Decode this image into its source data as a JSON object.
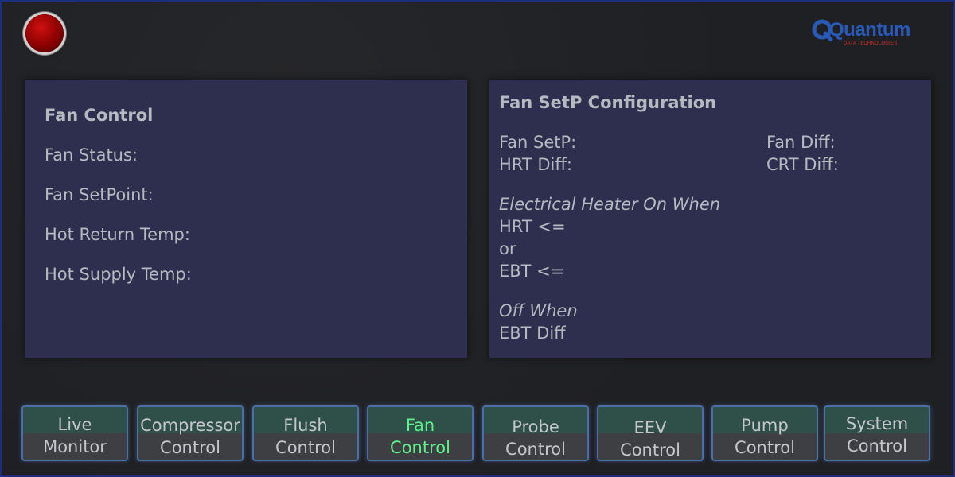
{
  "header": {
    "status_light": "red",
    "logo": {
      "brand": "Quantum",
      "tagline": "DATA TECHNOLOGIES",
      "brand_color": "#2a5ab8",
      "tagline_color": "#d03030"
    }
  },
  "fan_control": {
    "title": "Fan Control",
    "fields": [
      "Fan Status:",
      "Fan SetPoint:",
      "Hot Return Temp:",
      "Hot Supply Temp:"
    ]
  },
  "setp_config": {
    "title": "Fan SetP Configuration",
    "fan_setp": "Fan SetP:",
    "fan_diff": "Fan Diff:",
    "hrt_diff": "HRT Diff:",
    "crt_diff": "CRT Diff:",
    "heater_on_when": "Electrical Heater On When",
    "hrt_le": "HRT <=",
    "or": "or",
    "ebt_le": "EBT <=",
    "off_when": "Off When",
    "ebt_diff": "EBT Diff"
  },
  "nav": [
    {
      "line1": "Live",
      "line2": "Monitor",
      "active": false
    },
    {
      "line1": "Compressor",
      "line2": "Control",
      "active": false
    },
    {
      "line1": "Flush",
      "line2": "Control",
      "active": false
    },
    {
      "line1": "Fan",
      "line2": "Control",
      "active": true
    },
    {
      "line1": "Probe",
      "line2": "Control",
      "active": false
    },
    {
      "line1": "EEV",
      "line2": "Control",
      "active": false
    },
    {
      "line1": "Pump",
      "line2": "Control",
      "active": false
    },
    {
      "line1": "System",
      "line2": "Control",
      "active": false
    }
  ],
  "colors": {
    "panel": "#2e2e4e",
    "active_nav_text": "#5ff08a",
    "nav_border": "#4a6ea8"
  }
}
